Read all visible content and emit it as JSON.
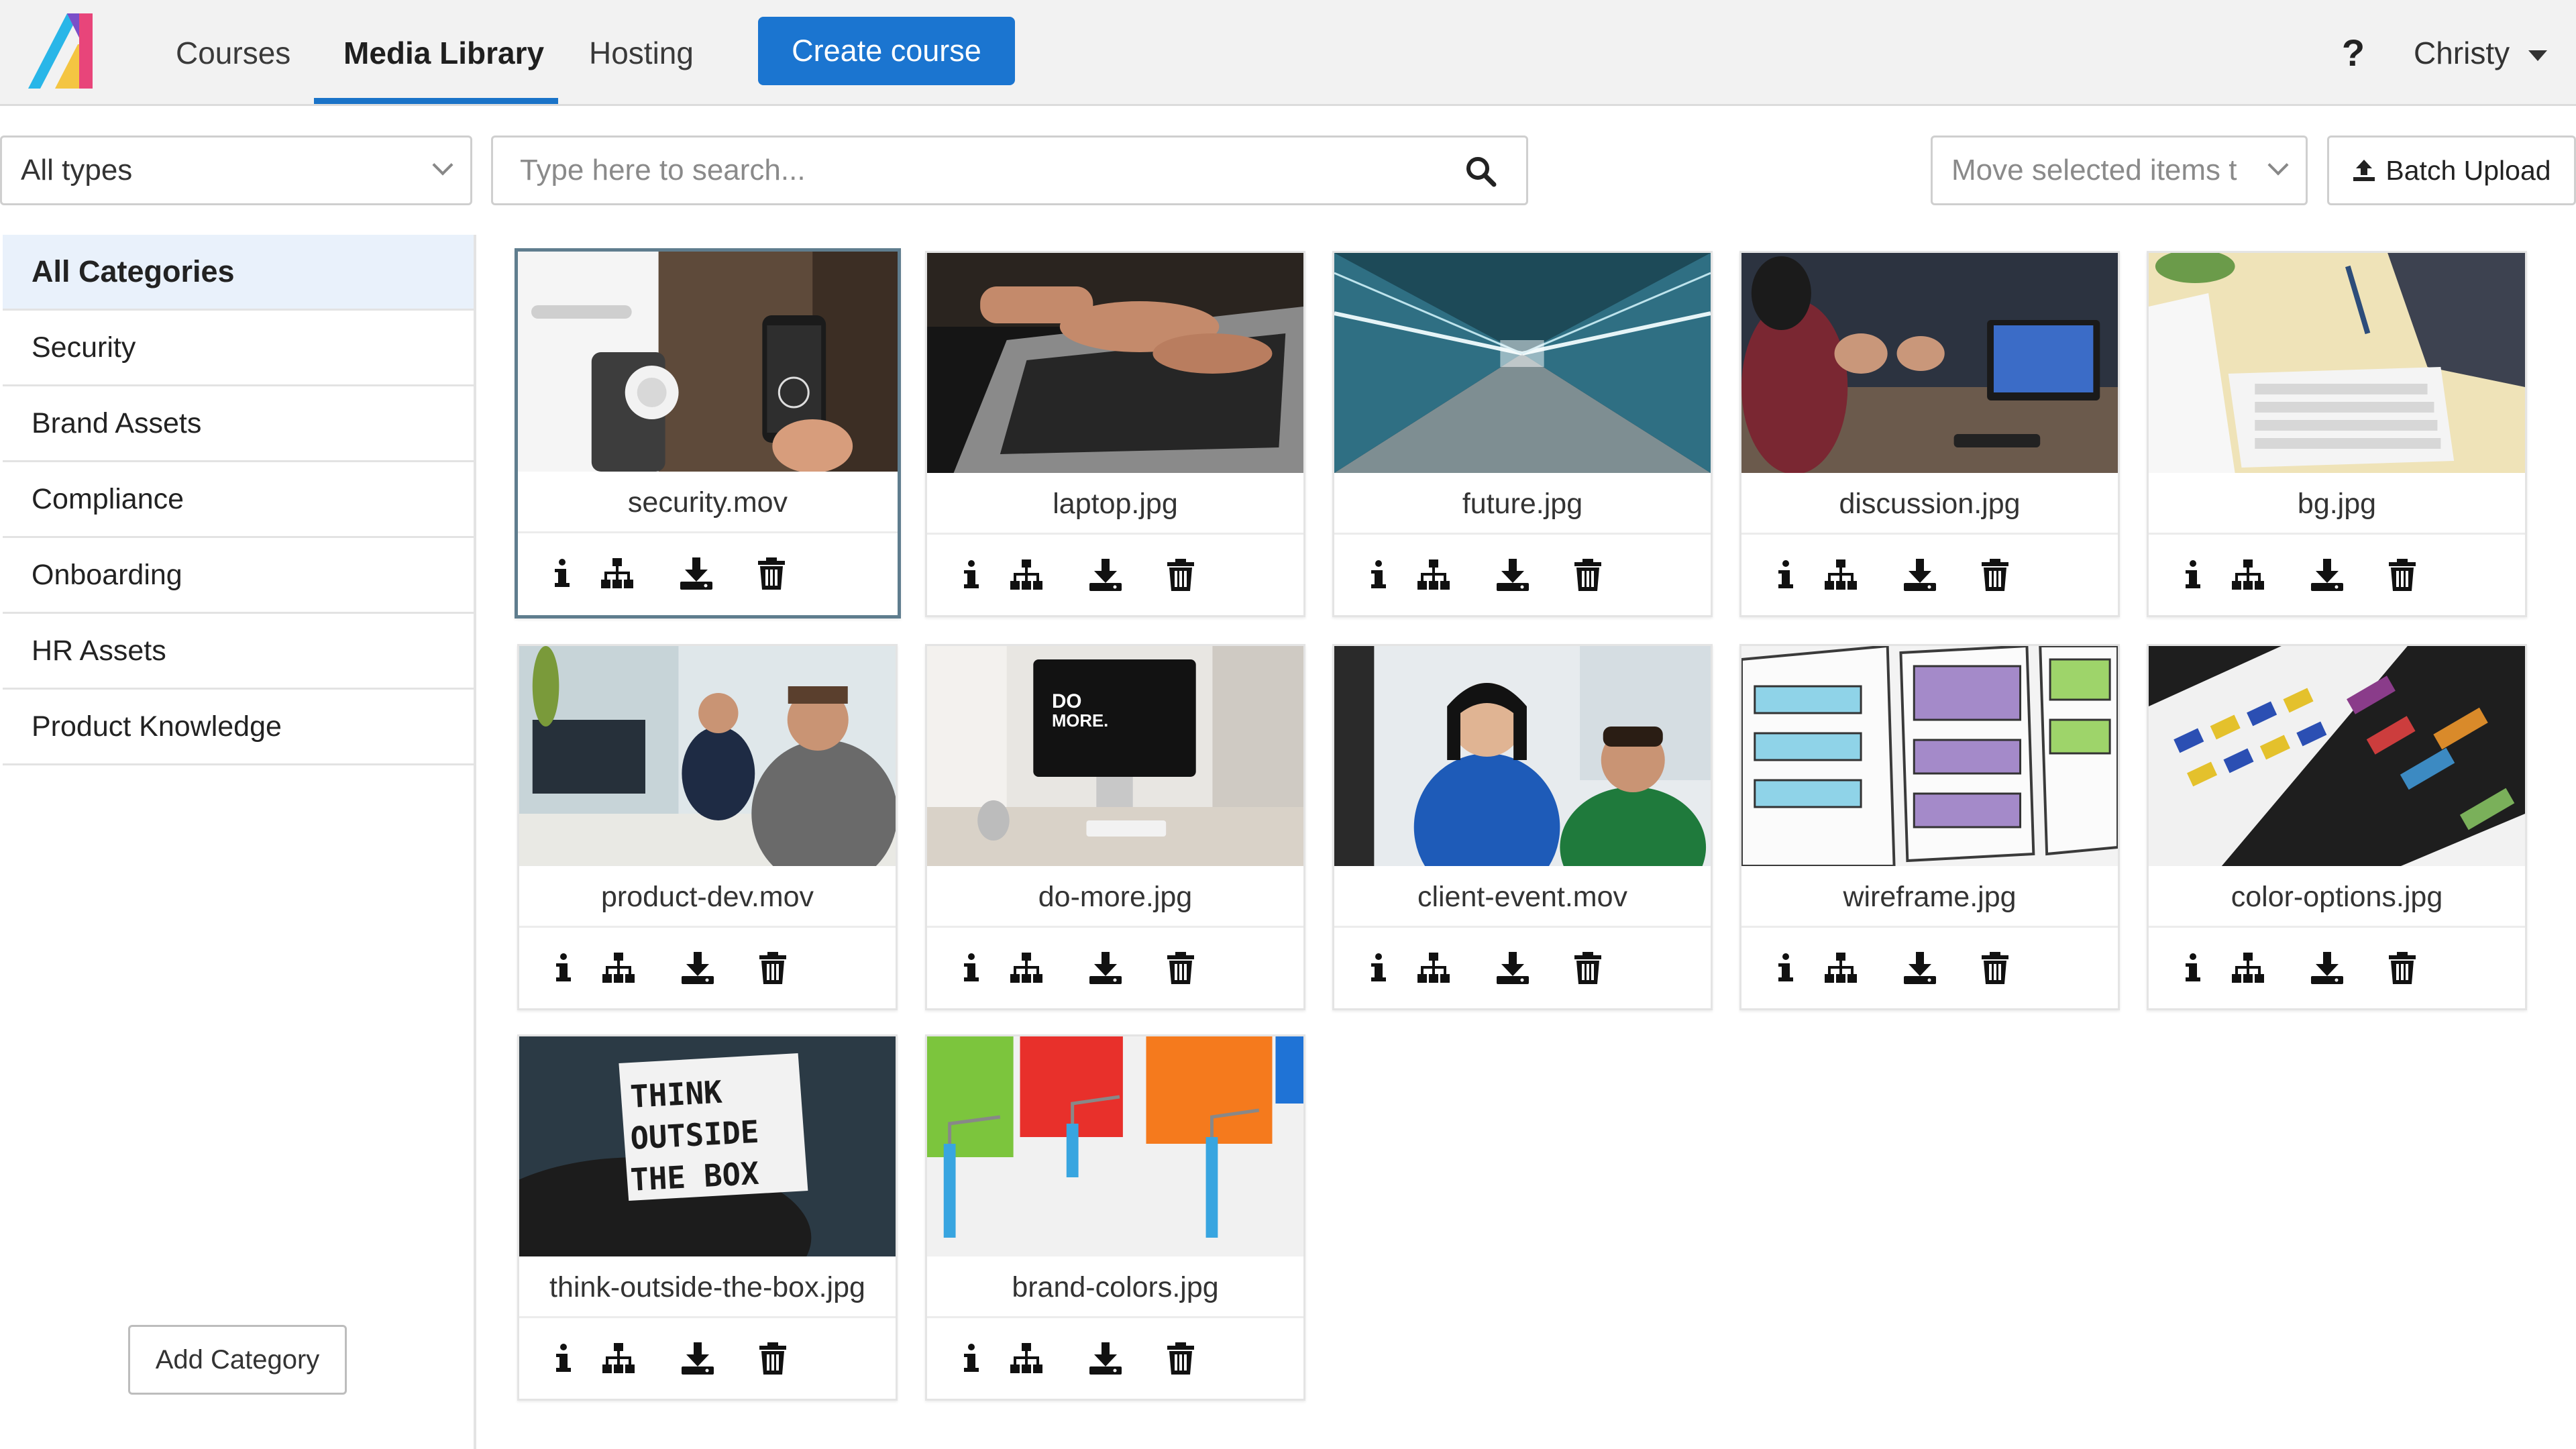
{
  "nav": {
    "tabs": [
      "Courses",
      "Media Library",
      "Hosting"
    ],
    "active_tab": "Media Library",
    "create_button": "Create course",
    "help": "?",
    "user": "Christy"
  },
  "toolbar": {
    "type_filter": "All types",
    "search_placeholder": "Type here to search...",
    "move_select": "Move selected items t",
    "batch_upload": "Batch Upload"
  },
  "sidebar": {
    "categories": [
      "All Categories",
      "Security",
      "Brand Assets",
      "Compliance",
      "Onboarding",
      "HR Assets",
      "Product Knowledge"
    ],
    "active": "All Categories",
    "add_button": "Add Category"
  },
  "media": [
    {
      "name": "security.mov",
      "thumb": "security-thumbnail"
    },
    {
      "name": "laptop.jpg",
      "thumb": "laptop-thumbnail"
    },
    {
      "name": "future.jpg",
      "thumb": "future-thumbnail"
    },
    {
      "name": "discussion.jpg",
      "thumb": "discussion-thumbnail"
    },
    {
      "name": "bg.jpg",
      "thumb": "bg-thumbnail"
    },
    {
      "name": "product-dev.mov",
      "thumb": "product-dev-thumbnail"
    },
    {
      "name": "do-more.jpg",
      "thumb": "do-more-thumbnail"
    },
    {
      "name": "client-event.mov",
      "thumb": "client-event-thumbnail"
    },
    {
      "name": "wireframe.jpg",
      "thumb": "wireframe-thumbnail"
    },
    {
      "name": "color-options.jpg",
      "thumb": "color-options-thumbnail"
    },
    {
      "name": "think-outside-the-box.jpg",
      "thumb": "think-outside-the-box-thumbnail"
    },
    {
      "name": "brand-colors.jpg",
      "thumb": "brand-colors-thumbnail"
    }
  ],
  "thumb_text": {
    "do_more": [
      "DO",
      "MORE."
    ],
    "lightbox": [
      "THINK",
      "OUTSIDE",
      "THE  BOX"
    ]
  },
  "icons": {
    "info": "info-icon",
    "hierarchy": "sitemap-icon",
    "download": "download-icon",
    "delete": "trash-icon"
  },
  "colors": {
    "accent": "#1b75d0",
    "selected_border": "#5f7d8e",
    "active_category_bg": "#e9f1fb"
  }
}
